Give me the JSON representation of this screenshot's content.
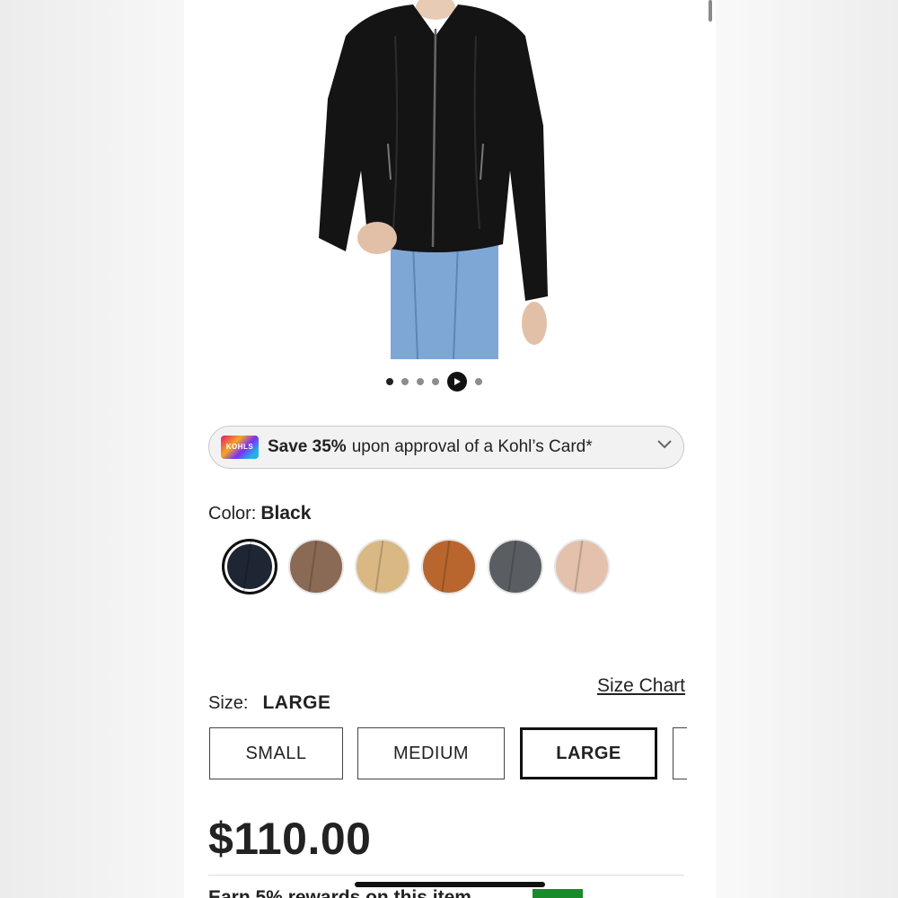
{
  "carousel": {
    "slide_count": 6,
    "active_index": 0,
    "video_index": 4
  },
  "promo": {
    "logo_text": "KOHLS",
    "bold": "Save 35%",
    "text": "upon approval of a Kohl’s Card*"
  },
  "color": {
    "label": "Color:",
    "value": "Black",
    "swatches": [
      {
        "name": "Black",
        "hex": "#1e2633",
        "selected": true
      },
      {
        "name": "Brown",
        "hex": "#8a6a55",
        "selected": false
      },
      {
        "name": "Tan",
        "hex": "#d9b883",
        "selected": false
      },
      {
        "name": "Cognac",
        "hex": "#b8662e",
        "selected": false
      },
      {
        "name": "Gray",
        "hex": "#5a5e63",
        "selected": false
      },
      {
        "name": "Blush",
        "hex": "#e3c1ad",
        "selected": false
      }
    ]
  },
  "size": {
    "label": "Size:",
    "value": "LARGE",
    "chart_link": "Size Chart",
    "options": [
      "SMALL",
      "MEDIUM",
      "LARGE",
      ""
    ],
    "selected_index": 2
  },
  "price": "$110.00",
  "rewards_text": "Earn 5% rewards on this item"
}
